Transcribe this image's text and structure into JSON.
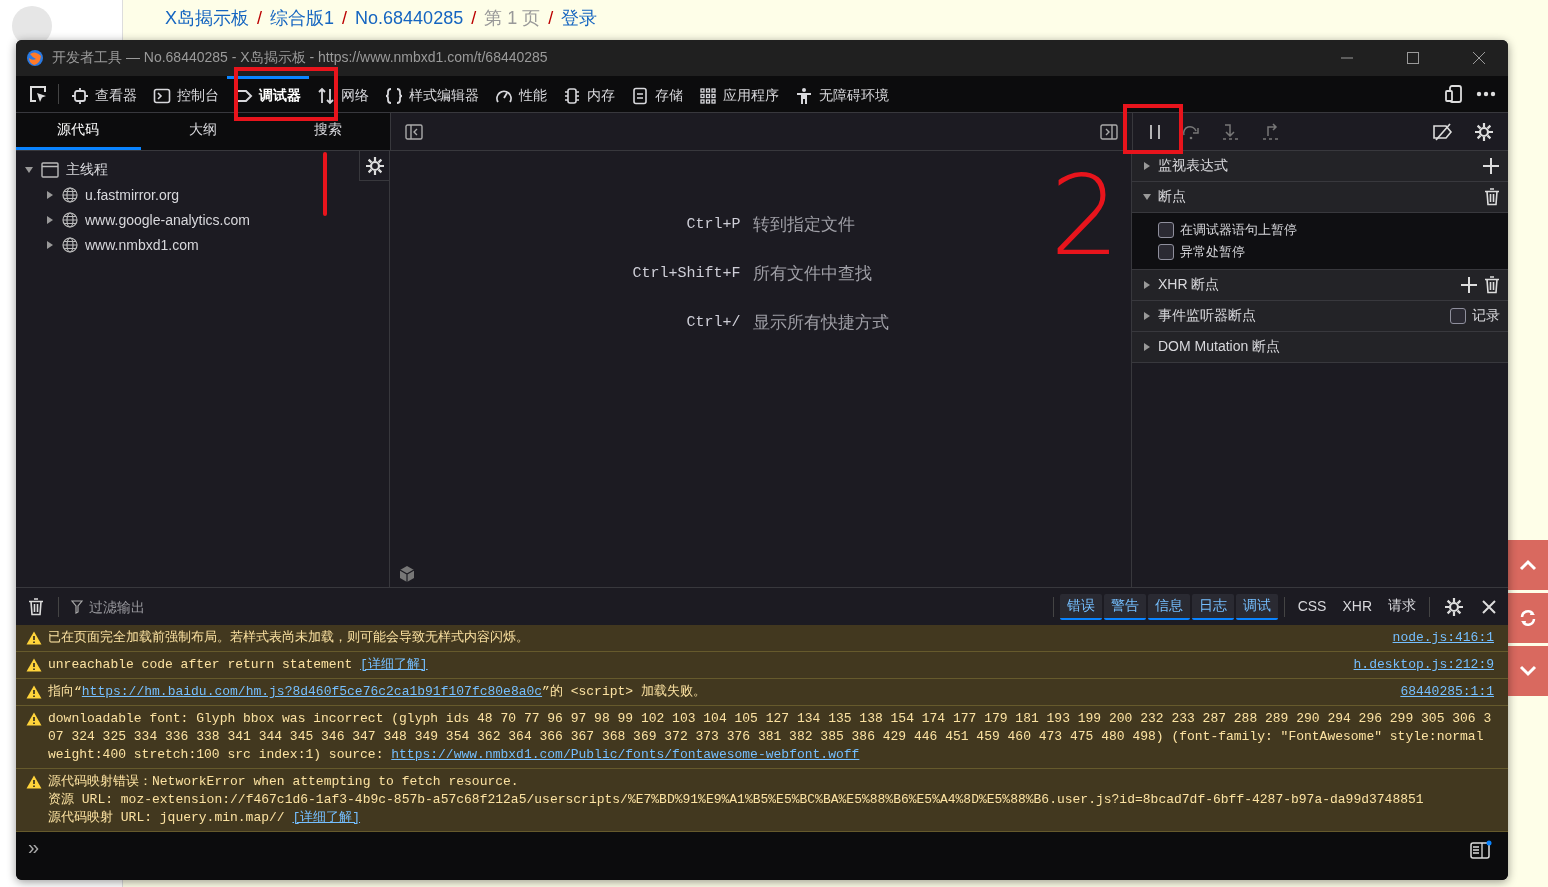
{
  "page": {
    "breadcrumb": [
      {
        "label": "X岛揭示板",
        "kind": "link"
      },
      {
        "label": "综合版1",
        "kind": "link",
        "separator": "/"
      },
      {
        "label": "No.68440285",
        "kind": "link",
        "separator": "/"
      },
      {
        "label": "第 1 页",
        "kind": "text",
        "separator": "/"
      },
      {
        "label": "登录",
        "kind": "link",
        "separator": "/"
      }
    ]
  },
  "window": {
    "title": "开发者工具 — No.68440285 - X岛揭示板 - https://www.nmbxd1.com/t/68440285"
  },
  "tools": [
    {
      "label": "查看器",
      "selected": false
    },
    {
      "label": "控制台",
      "selected": false
    },
    {
      "label": "调试器",
      "selected": true
    },
    {
      "label": "网络",
      "selected": false
    },
    {
      "label": "样式编辑器",
      "selected": false
    },
    {
      "label": "性能",
      "selected": false
    },
    {
      "label": "内存",
      "selected": false
    },
    {
      "label": "存储",
      "selected": false
    },
    {
      "label": "应用程序",
      "selected": false
    },
    {
      "label": "无障碍环境",
      "selected": false
    }
  ],
  "source_tabs": [
    {
      "label": "源代码",
      "selected": true
    },
    {
      "label": "大纲",
      "selected": false
    },
    {
      "label": "搜索",
      "selected": false
    }
  ],
  "tree": {
    "label": "主线程",
    "expanded": true,
    "children": [
      {
        "label": "u.fastmirror.org",
        "expanded": false
      },
      {
        "label": "www.google-analytics.com",
        "expanded": false
      },
      {
        "label": "www.nmbxd1.com",
        "expanded": false
      }
    ]
  },
  "shortcuts": [
    {
      "keys": "Ctrl+P",
      "label": "转到指定文件"
    },
    {
      "keys": "Ctrl+Shift+F",
      "label": "所有文件中查找"
    },
    {
      "keys": "Ctrl+/",
      "label": "显示所有快捷方式"
    }
  ],
  "panels": [
    {
      "title": "监视表达式",
      "expanded": false,
      "actions": [
        {
          "kind": "add"
        }
      ]
    },
    {
      "title": "断点",
      "expanded": true,
      "actions": [
        {
          "kind": "delete"
        }
      ],
      "options": [
        {
          "label": "在调试器语句上暂停",
          "checked": false
        },
        {
          "label": "异常处暂停",
          "checked": false
        }
      ]
    },
    {
      "title": "XHR 断点",
      "expanded": false,
      "actions": [
        {
          "kind": "add"
        },
        {
          "kind": "delete"
        }
      ]
    },
    {
      "title": "事件监听器断点",
      "expanded": false,
      "record": {
        "label": "记录",
        "checked": false
      }
    },
    {
      "title": "DOM Mutation 断点",
      "expanded": false
    }
  ],
  "console": {
    "filter": {
      "placeholder": "过滤输出"
    },
    "levels": [
      {
        "label": "错误",
        "selected": true
      },
      {
        "label": "警告",
        "selected": true
      },
      {
        "label": "信息",
        "selected": true
      },
      {
        "label": "日志",
        "selected": true
      },
      {
        "label": "调试",
        "selected": true
      }
    ],
    "types": [
      {
        "label": "CSS",
        "selected": false
      },
      {
        "label": "XHR",
        "selected": false
      },
      {
        "label": "请求",
        "selected": false
      }
    ],
    "messages": [
      {
        "kind": "warning",
        "source": "node.js:416:1",
        "lines": [
          [
            {
              "kind": "text",
              "text": "已在页面完全加载前强制布局。若样式表尚未加载，则可能会导致无样式内容闪烁。"
            }
          ]
        ]
      },
      {
        "kind": "warning",
        "source": "h.desktop.js:212:9",
        "lines": [
          [
            {
              "kind": "text",
              "text": "unreachable code after return statement "
            },
            {
              "kind": "link",
              "text": "[详细了解]"
            }
          ]
        ]
      },
      {
        "kind": "warning",
        "source": "68440285:1:1",
        "lines": [
          [
            {
              "kind": "text",
              "text": "指向“"
            },
            {
              "kind": "link",
              "text": "https://hm.baidu.com/hm.js?8d460f5ce76c2ca1b91f107fc80e8a0c"
            },
            {
              "kind": "text",
              "text": "”的 <script> 加载失败。"
            }
          ]
        ]
      },
      {
        "kind": "warning",
        "lines": [
          [
            {
              "kind": "text",
              "text": "downloadable font: Glyph bbox was incorrect (glyph ids 48 70 77 96 97 98 99 102 103 104 105 127 134 135 138 154 174 177 179 181 193 199 200 232 233 287 288 289 290 294 296 299 305 306 307 324 325 334 336 338 341 344 345 346 347 348 349 354 362 364 366 367 368 369 372 373 376 381 382 385 386 429 446 451 459 460 473 475 480 498) (font-family: \"FontAwesome\" style:normal weight:400 stretch:100 src index:1) source: "
            },
            {
              "kind": "link",
              "text": "https://www.nmbxd1.com/Public/fonts/fontawesome-webfont.woff"
            }
          ]
        ]
      },
      {
        "kind": "warning",
        "lines": [
          [
            {
              "kind": "text",
              "text": "源代码映射错误：NetworkError when attempting to fetch resource."
            }
          ],
          [
            {
              "kind": "text",
              "text": "资源 URL: moz-extension://f467c1d6-1af3-4b9c-857b-a57c68f212a5/userscripts/%E7%BD%91%E9%A1%B5%E5%BC%BA%E5%88%B6%E5%A4%8D%E5%88%B6.user.js?id=8bcad7df-6bff-4287-b97a-da99d3748851"
            }
          ],
          [
            {
              "kind": "text",
              "text": "源代码映射 URL: jquery.min.map// "
            },
            {
              "kind": "link",
              "text": "[详细了解]"
            }
          ]
        ]
      }
    ],
    "prompt": "»"
  },
  "annotations": {
    "number": "2"
  }
}
